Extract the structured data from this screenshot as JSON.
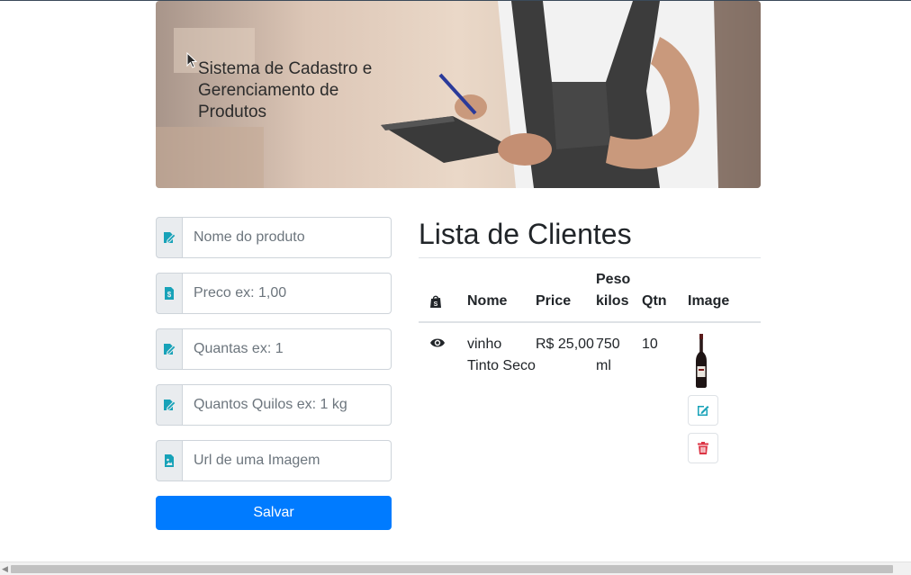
{
  "banner": {
    "title": "Sistema de Cadastro e Gerenciamento de Produtos"
  },
  "form": {
    "fields": [
      {
        "name": "product-name",
        "placeholder": "Nome do produto",
        "icon": "edit-icon"
      },
      {
        "name": "price",
        "placeholder": "Preco ex: 1,00",
        "icon": "dollar-file-icon"
      },
      {
        "name": "quantity",
        "placeholder": "Quantas ex: 1",
        "icon": "edit-icon"
      },
      {
        "name": "weight",
        "placeholder": "Quantos Quilos ex: 1 kg",
        "icon": "edit-icon"
      },
      {
        "name": "image-url",
        "placeholder": "Url de uma Imagem",
        "icon": "image-file-icon"
      }
    ],
    "save_label": "Salvar"
  },
  "list": {
    "title": "Lista de Clientes",
    "headers": [
      "",
      "Nome",
      "Price",
      "Peso kilos",
      "Qtn",
      "Image"
    ],
    "rows": [
      {
        "name": "vinho Tinto Seco",
        "price": "R$ 25,00",
        "weight": "750 ml",
        "qty": "10"
      }
    ]
  },
  "colors": {
    "accent": "#007bff",
    "icon_teal": "#17a2b8",
    "danger": "#dc3545"
  }
}
